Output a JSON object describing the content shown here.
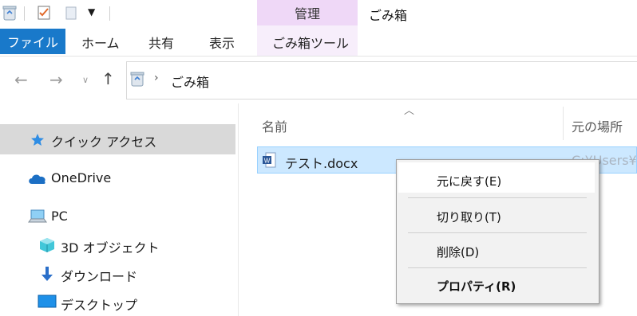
{
  "title_bar": {
    "context_tab_header": "管理",
    "window_title": "ごみ箱"
  },
  "ribbon": {
    "tabs": [
      "ファイル",
      "ホーム",
      "共有",
      "表示",
      "ごみ箱ツール"
    ]
  },
  "address_bar": {
    "path": [
      "ごみ箱"
    ]
  },
  "nav_pane": {
    "items": [
      "クイック アクセス",
      "OneDrive",
      "PC",
      "3D オブジェクト",
      "ダウンロード",
      "デスクトップ"
    ]
  },
  "file_list": {
    "columns": [
      "名前",
      "元の場所"
    ],
    "rows": [
      {
        "name": "テスト.docx",
        "original_location": "C:¥Users¥k"
      }
    ]
  },
  "context_menu": {
    "items": [
      "元に戻す(E)",
      "切り取り(T)",
      "削除(D)",
      "プロパティ(R)"
    ]
  },
  "colors": {
    "file_tab": "#1979ca",
    "context_tab": "#efd8f7",
    "selection": "#cce8ff",
    "selection_border": "#99d1ff",
    "nav_selected": "#d9d9d9",
    "menu_bg": "#f2f2f2"
  },
  "icons": [
    "recycle-bin-icon",
    "properties-check-icon",
    "new-folder-icon",
    "dropdown-icon",
    "back-arrow-icon",
    "forward-arrow-icon",
    "recent-dropdown-icon",
    "up-arrow-icon",
    "star-icon",
    "cloud-icon",
    "computer-icon",
    "cube-3d-icon",
    "download-arrow-icon",
    "desktop-icon",
    "word-doc-icon",
    "sort-ascending-icon"
  ]
}
